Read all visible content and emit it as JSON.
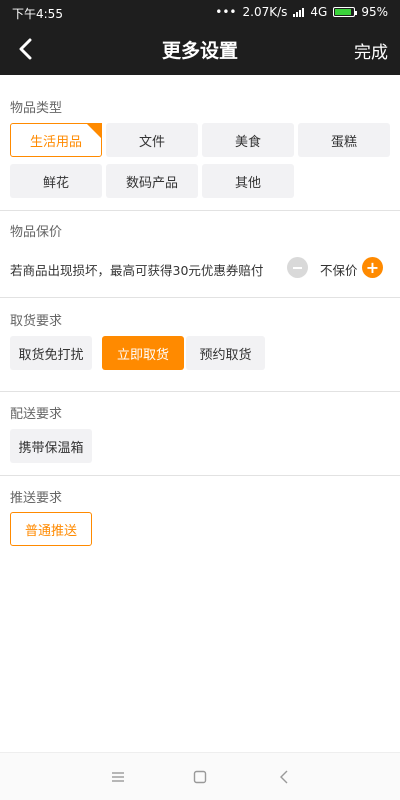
{
  "status_bar": {
    "time": "下午4:55",
    "speed": "2.07K/s",
    "network": "4G",
    "battery": "95%"
  },
  "nav": {
    "title": "更多设置",
    "done_label": "完成"
  },
  "item_type": {
    "title": "物品类型",
    "options": [
      "生活用品",
      "文件",
      "美食",
      "蛋糕",
      "鲜花",
      "数码产品",
      "其他"
    ],
    "selected": "生活用品"
  },
  "insurance": {
    "title": "物品保价",
    "description": "若商品出现损坏，最高可获得30元优惠券赔付",
    "value": "不保价"
  },
  "pickup": {
    "title": "取货要求",
    "options": [
      "取货免打扰",
      "立即取货",
      "预约取货"
    ],
    "selected": "立即取货"
  },
  "delivery": {
    "title": "配送要求",
    "options": [
      "携带保温箱"
    ]
  },
  "push": {
    "title": "推送要求",
    "options": [
      "普通推送"
    ],
    "selected": "普通推送"
  },
  "colors": {
    "accent": "#ff8a00",
    "header_bg": "#1e1e1e",
    "chip_bg": "#f2f2f4"
  },
  "icons": [
    "back-arrow-icon",
    "minus-icon",
    "plus-icon",
    "menu-icon",
    "home-icon",
    "back-icon"
  ]
}
